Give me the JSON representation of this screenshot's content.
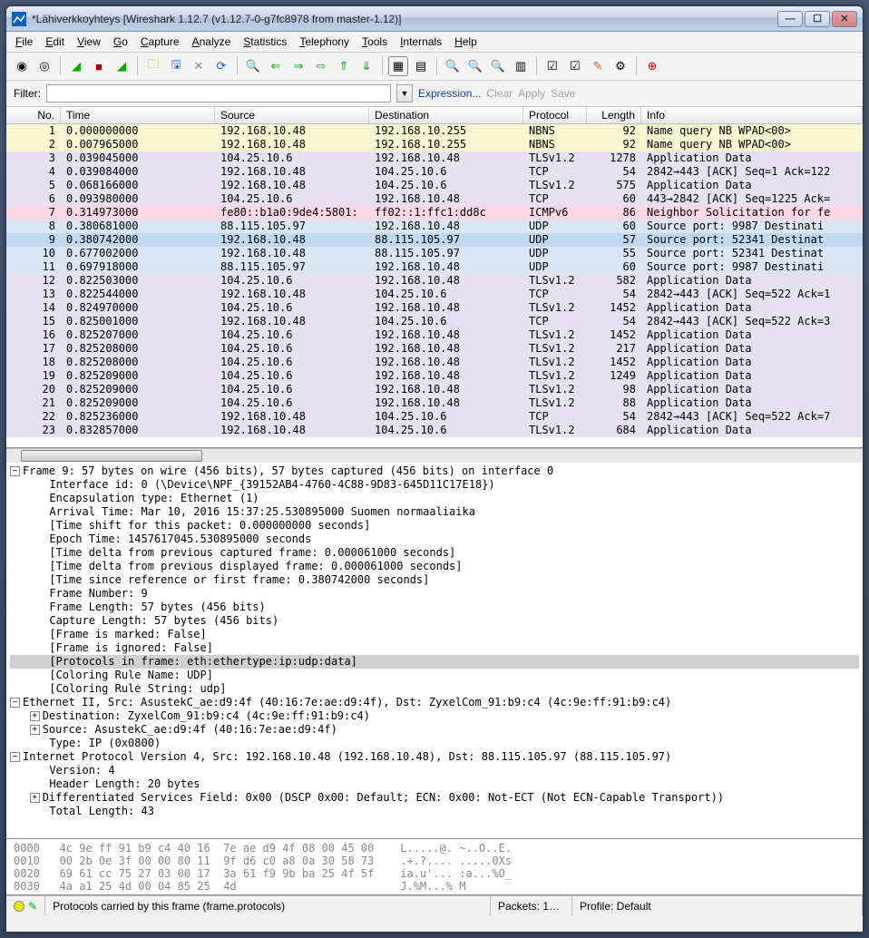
{
  "window": {
    "title": "*Lähiverkkoyhteys   [Wireshark 1.12.7  (v1.12.7-0-g7fc8978 from master-1.12)]"
  },
  "menu": [
    "File",
    "Edit",
    "View",
    "Go",
    "Capture",
    "Analyze",
    "Statistics",
    "Telephony",
    "Tools",
    "Internals",
    "Help"
  ],
  "filter": {
    "label": "Filter:",
    "value": "",
    "links": [
      "Expression...",
      "Clear",
      "Apply",
      "Save"
    ]
  },
  "columns": [
    "No.",
    "Time",
    "Source",
    "Destination",
    "Protocol",
    "Length",
    "Info"
  ],
  "colors": {
    "nbns": "#fbf6d1",
    "tcp": "#e6e1f0",
    "tlsv": "#e6e1f0",
    "icmp": "#fdd7e4",
    "udp": "#dae6f3",
    "sel": "#cde2ff"
  },
  "packets": [
    {
      "no": "1",
      "time": "0.000000000",
      "src": "192.168.10.48",
      "dst": "192.168.10.255",
      "proto": "NBNS",
      "len": "92",
      "info": "Name query NB WPAD<00>",
      "c": "nbns"
    },
    {
      "no": "2",
      "time": "0.007965000",
      "src": "192.168.10.48",
      "dst": "192.168.10.255",
      "proto": "NBNS",
      "len": "92",
      "info": "Name query NB WPAD<00>",
      "c": "nbns"
    },
    {
      "no": "3",
      "time": "0.039045000",
      "src": "104.25.10.6",
      "dst": "192.168.10.48",
      "proto": "TLSv1.2",
      "len": "1278",
      "info": "Application Data",
      "c": "tlsv"
    },
    {
      "no": "4",
      "time": "0.039084000",
      "src": "192.168.10.48",
      "dst": "104.25.10.6",
      "proto": "TCP",
      "len": "54",
      "info": "2842→443 [ACK] Seq=1 Ack=122",
      "c": "tcp"
    },
    {
      "no": "5",
      "time": "0.068166000",
      "src": "192.168.10.48",
      "dst": "104.25.10.6",
      "proto": "TLSv1.2",
      "len": "575",
      "info": "Application Data",
      "c": "tlsv"
    },
    {
      "no": "6",
      "time": "0.093980000",
      "src": "104.25.10.6",
      "dst": "192.168.10.48",
      "proto": "TCP",
      "len": "60",
      "info": "443→2842 [ACK] Seq=1225 Ack=",
      "c": "tcp"
    },
    {
      "no": "7",
      "time": "0.314973000",
      "src": "fe80::b1a0:9de4:5801:",
      "dst": "ff02::1:ffc1:dd8c",
      "proto": "ICMPv6",
      "len": "86",
      "info": "Neighbor Solicitation for fe",
      "c": "icmp"
    },
    {
      "no": "8",
      "time": "0.380681000",
      "src": "88.115.105.97",
      "dst": "192.168.10.48",
      "proto": "UDP",
      "len": "60",
      "info": "Source port: 9987   Destinati",
      "c": "udp"
    },
    {
      "no": "9",
      "time": "0.380742000",
      "src": "192.168.10.48",
      "dst": "88.115.105.97",
      "proto": "UDP",
      "len": "57",
      "info": "Source port: 52341   Destinat",
      "c": "udp",
      "sel": true
    },
    {
      "no": "10",
      "time": "0.677002000",
      "src": "192.168.10.48",
      "dst": "88.115.105.97",
      "proto": "UDP",
      "len": "55",
      "info": "Source port: 52341   Destinat",
      "c": "udp"
    },
    {
      "no": "11",
      "time": "0.697918000",
      "src": "88.115.105.97",
      "dst": "192.168.10.48",
      "proto": "UDP",
      "len": "60",
      "info": "Source port: 9987   Destinati",
      "c": "udp"
    },
    {
      "no": "12",
      "time": "0.822503000",
      "src": "104.25.10.6",
      "dst": "192.168.10.48",
      "proto": "TLSv1.2",
      "len": "582",
      "info": "Application Data",
      "c": "tlsv"
    },
    {
      "no": "13",
      "time": "0.822544000",
      "src": "192.168.10.48",
      "dst": "104.25.10.6",
      "proto": "TCP",
      "len": "54",
      "info": "2842→443 [ACK] Seq=522 Ack=1",
      "c": "tcp"
    },
    {
      "no": "14",
      "time": "0.824970000",
      "src": "104.25.10.6",
      "dst": "192.168.10.48",
      "proto": "TLSv1.2",
      "len": "1452",
      "info": "Application Data",
      "c": "tlsv"
    },
    {
      "no": "15",
      "time": "0.825001000",
      "src": "192.168.10.48",
      "dst": "104.25.10.6",
      "proto": "TCP",
      "len": "54",
      "info": "2842→443 [ACK] Seq=522 Ack=3",
      "c": "tcp"
    },
    {
      "no": "16",
      "time": "0.825207000",
      "src": "104.25.10.6",
      "dst": "192.168.10.48",
      "proto": "TLSv1.2",
      "len": "1452",
      "info": "Application Data",
      "c": "tlsv"
    },
    {
      "no": "17",
      "time": "0.825208000",
      "src": "104.25.10.6",
      "dst": "192.168.10.48",
      "proto": "TLSv1.2",
      "len": "217",
      "info": "Application Data",
      "c": "tlsv"
    },
    {
      "no": "18",
      "time": "0.825208000",
      "src": "104.25.10.6",
      "dst": "192.168.10.48",
      "proto": "TLSv1.2",
      "len": "1452",
      "info": "Application Data",
      "c": "tlsv"
    },
    {
      "no": "19",
      "time": "0.825209000",
      "src": "104.25.10.6",
      "dst": "192.168.10.48",
      "proto": "TLSv1.2",
      "len": "1249",
      "info": "Application Data",
      "c": "tlsv"
    },
    {
      "no": "20",
      "time": "0.825209000",
      "src": "104.25.10.6",
      "dst": "192.168.10.48",
      "proto": "TLSv1.2",
      "len": "98",
      "info": "Application Data",
      "c": "tlsv"
    },
    {
      "no": "21",
      "time": "0.825209000",
      "src": "104.25.10.6",
      "dst": "192.168.10.48",
      "proto": "TLSv1.2",
      "len": "88",
      "info": "Application Data",
      "c": "tlsv"
    },
    {
      "no": "22",
      "time": "0.825236000",
      "src": "192.168.10.48",
      "dst": "104.25.10.6",
      "proto": "TCP",
      "len": "54",
      "info": "2842→443 [ACK] Seq=522 Ack=7",
      "c": "tcp"
    },
    {
      "no": "23",
      "time": "0.832857000",
      "src": "192.168.10.48",
      "dst": "104.25.10.6",
      "proto": "TLSv1.2",
      "len": "684",
      "info": "Application Data",
      "c": "tlsv"
    }
  ],
  "details": [
    {
      "ind": 0,
      "exp": "-",
      "text": "Frame 9: 57 bytes on wire (456 bits), 57 bytes captured (456 bits) on interface 0"
    },
    {
      "ind": 1,
      "text": "Interface id: 0 (\\Device\\NPF_{39152AB4-4760-4C88-9D83-645D11C17E18})"
    },
    {
      "ind": 1,
      "text": "Encapsulation type: Ethernet (1)"
    },
    {
      "ind": 1,
      "text": "Arrival Time: Mar 10, 2016 15:37:25.530895000 Suomen normaaliaika"
    },
    {
      "ind": 1,
      "text": "[Time shift for this packet: 0.000000000 seconds]"
    },
    {
      "ind": 1,
      "text": "Epoch Time: 1457617045.530895000 seconds"
    },
    {
      "ind": 1,
      "text": "[Time delta from previous captured frame: 0.000061000 seconds]"
    },
    {
      "ind": 1,
      "text": "[Time delta from previous displayed frame: 0.000061000 seconds]"
    },
    {
      "ind": 1,
      "text": "[Time since reference or first frame: 0.380742000 seconds]"
    },
    {
      "ind": 1,
      "text": "Frame Number: 9"
    },
    {
      "ind": 1,
      "text": "Frame Length: 57 bytes (456 bits)"
    },
    {
      "ind": 1,
      "text": "Capture Length: 57 bytes (456 bits)"
    },
    {
      "ind": 1,
      "text": "[Frame is marked: False]"
    },
    {
      "ind": 1,
      "text": "[Frame is ignored: False]"
    },
    {
      "ind": 1,
      "text": "[Protocols in frame: eth:ethertype:ip:udp:data]",
      "sel": true
    },
    {
      "ind": 1,
      "text": "[Coloring Rule Name: UDP]"
    },
    {
      "ind": 1,
      "text": "[Coloring Rule String: udp]"
    },
    {
      "ind": 0,
      "exp": "-",
      "text": "Ethernet II, Src: AsustekC_ae:d9:4f (40:16:7e:ae:d9:4f), Dst: ZyxelCom_91:b9:c4 (4c:9e:ff:91:b9:c4)"
    },
    {
      "ind": 1,
      "exp": "+",
      "text": "Destination: ZyxelCom_91:b9:c4 (4c:9e:ff:91:b9:c4)"
    },
    {
      "ind": 1,
      "exp": "+",
      "text": "Source: AsustekC_ae:d9:4f (40:16:7e:ae:d9:4f)"
    },
    {
      "ind": 1,
      "text": "Type: IP (0x0800)"
    },
    {
      "ind": 0,
      "exp": "-",
      "text": "Internet Protocol Version 4, Src: 192.168.10.48 (192.168.10.48), Dst: 88.115.105.97 (88.115.105.97)"
    },
    {
      "ind": 1,
      "text": "Version: 4"
    },
    {
      "ind": 1,
      "text": "Header Length: 20 bytes"
    },
    {
      "ind": 1,
      "exp": "+",
      "text": "Differentiated Services Field: 0x00 (DSCP 0x00: Default; ECN: 0x00: Not-ECT (Not ECN-Capable Transport))"
    },
    {
      "ind": 1,
      "text": "Total Length: 43"
    }
  ],
  "hex": [
    "0000   4c 9e ff 91 b9 c4 40 16  7e ae d9 4f 08 00 45 00    L.....@. ~..O..E.",
    "0010   00 2b 0e 3f 00 00 80 11  9f d6 c0 a8 0a 30 58 73    .+.?.... .....0Xs",
    "0020   69 61 cc 75 27 03 00 17  3a 61 f9 9b ba 25 4f 5f    ia.u'... :a...%O_",
    "0030   4a a1 25 4d 00 04 85 25  4d                         J.%M...% M"
  ],
  "status": {
    "field": "Protocols carried by this frame (frame.protocols)",
    "packets": "Packets: 1…",
    "profile": "Profile: Default"
  }
}
